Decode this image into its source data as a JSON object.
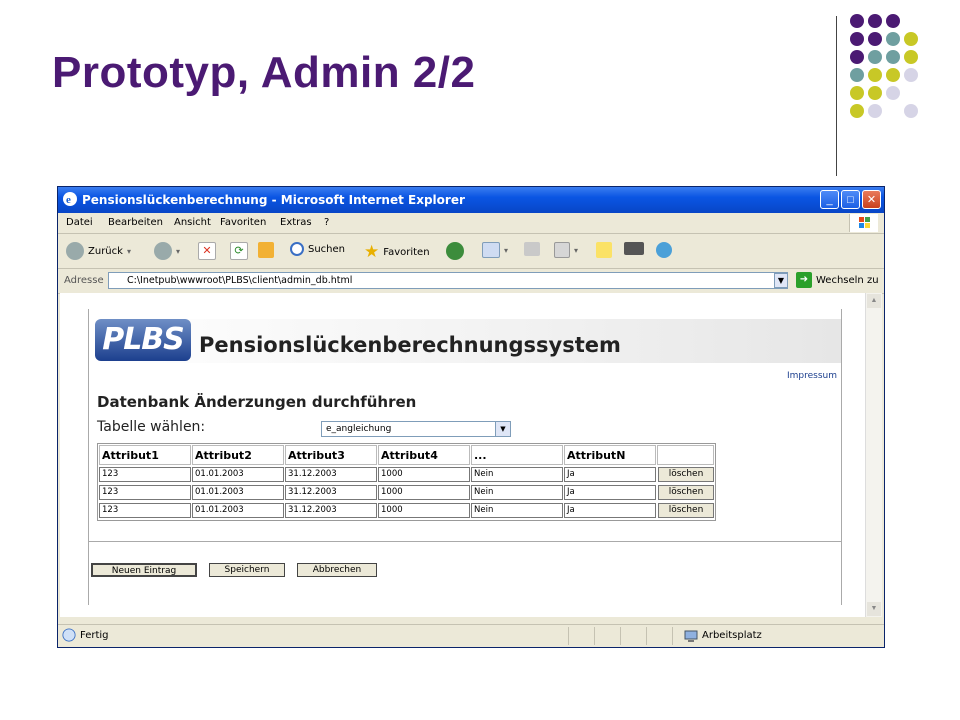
{
  "slide": {
    "title": "Prototyp, Admin 2/2"
  },
  "browser": {
    "title": "Pensionslückenberechnung - Microsoft Internet Explorer",
    "menu": [
      "Datei",
      "Bearbeiten",
      "Ansicht",
      "Favoriten",
      "Extras",
      "?"
    ],
    "toolbar": {
      "back": "Zurück",
      "search": "Suchen",
      "favorites": "Favoriten"
    },
    "address_label": "Adresse",
    "address": "C:\\Inetpub\\wwwroot\\PLBS\\client\\admin_db.html",
    "go": "Wechseln zu",
    "status_left": "Fertig",
    "status_right": "Arbeitsplatz"
  },
  "page": {
    "logo": "PLBS",
    "app_title": "Pensionslückenberechnungssystem",
    "impressum": "Impressum",
    "heading": "Datenbank Änderzungen durchführen",
    "table_label": "Tabelle wählen:",
    "table_select": "e_angleichung",
    "columns": [
      "Attribut1",
      "Attribut2",
      "Attribut3",
      "Attribut4",
      "...",
      "AttributN"
    ],
    "rows": [
      [
        "123",
        "01.01.2003",
        "31.12.2003",
        "1000",
        "Nein",
        "Ja"
      ],
      [
        "123",
        "01.01.2003",
        "31.12.2003",
        "1000",
        "Nein",
        "Ja"
      ],
      [
        "123",
        "01.01.2003",
        "31.12.2003",
        "1000",
        "Nein",
        "Ja"
      ]
    ],
    "delete_label": "löschen",
    "buttons": {
      "new": "Neuen Eintrag",
      "save": "Speichern",
      "cancel": "Abbrechen"
    }
  },
  "colors": {
    "title": "#4b1a73",
    "dot_purple": "#4b1a73",
    "dot_teal": "#6f9fa0",
    "dot_yellow": "#c8c826",
    "dot_lilac": "#d6d4e6"
  }
}
